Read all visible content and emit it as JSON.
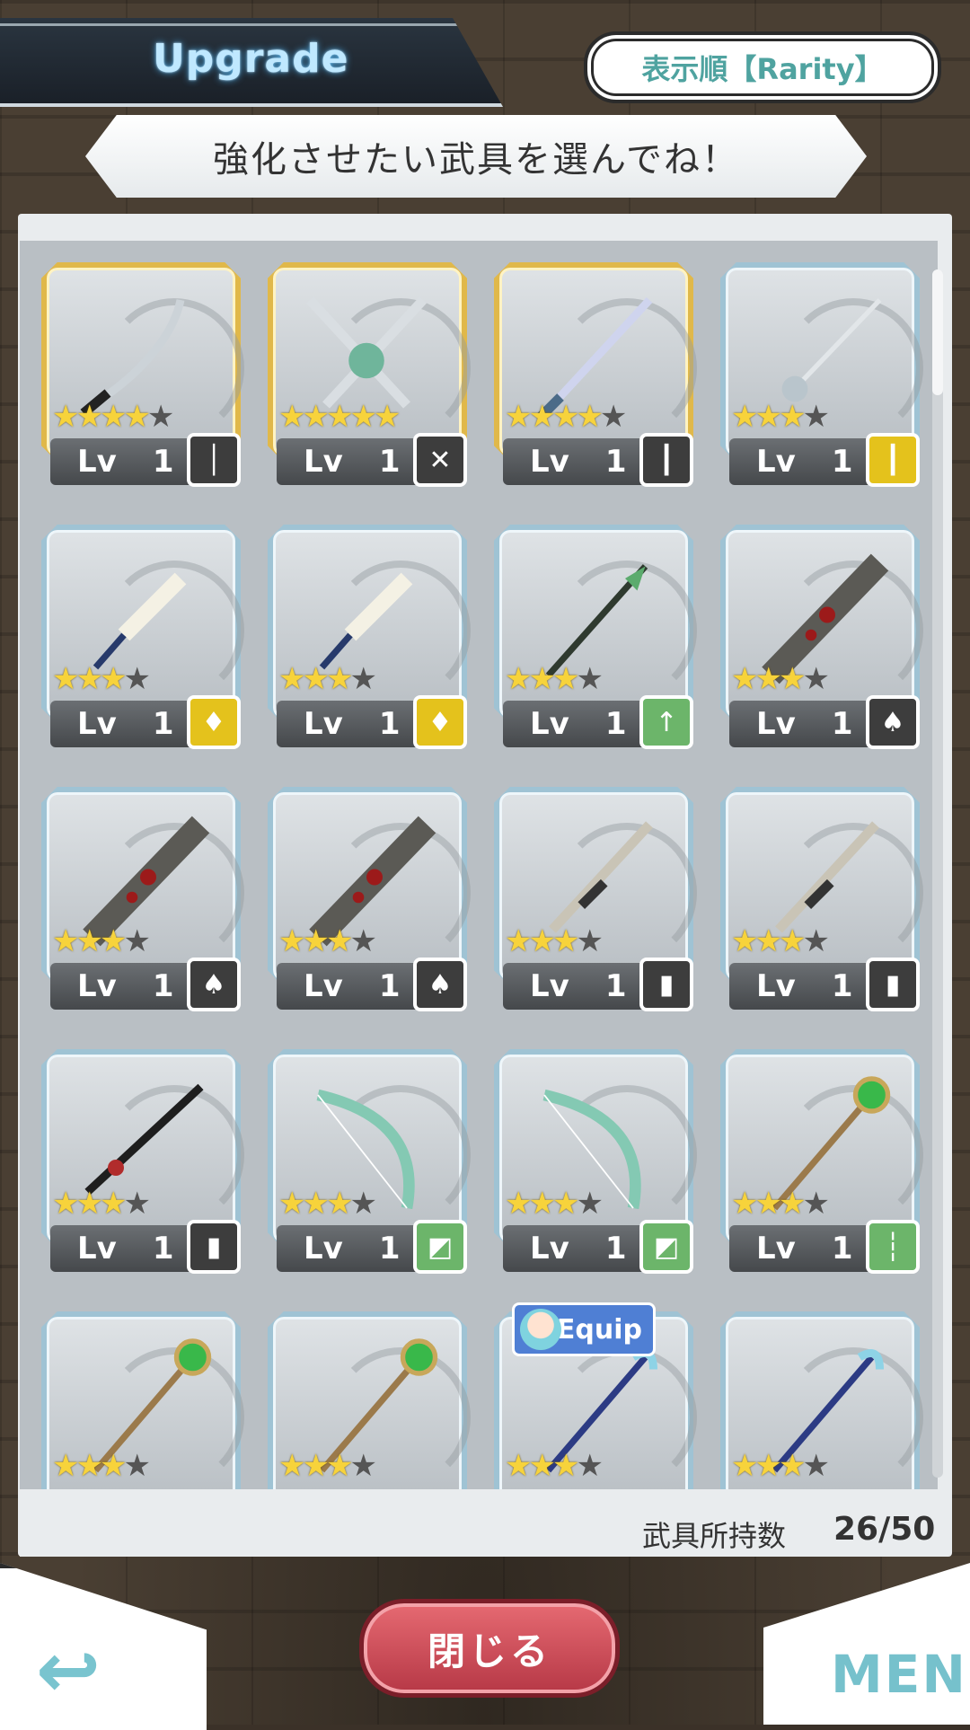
{
  "header": {
    "title": "Upgrade",
    "sort_label": "表示順【Rarity】",
    "instruction": "強化させたい武具を選んでね！"
  },
  "colors": {
    "accent": "#76c1cc",
    "gold_frame": "#e0b84a",
    "silver_frame": "#9fc3d4",
    "star": "#f7d33b",
    "close_button": "#c94b57",
    "badge_yellow": "#e4c21c",
    "badge_green": "#6cb56a",
    "badge_dark": "#3d3d3d"
  },
  "inventory": {
    "label": "武具所持数",
    "count": "26/50"
  },
  "items": [
    {
      "rarity": 4,
      "max": 5,
      "level": "1",
      "frame": "gold",
      "badge": "dark",
      "badge_icon": "sword-icon",
      "art": "katana"
    },
    {
      "rarity": 5,
      "max": 5,
      "level": "1",
      "frame": "gold",
      "badge": "dark",
      "badge_icon": "dual-swords-icon",
      "art": "crossed-swords"
    },
    {
      "rarity": 4,
      "max": 5,
      "level": "1",
      "frame": "gold",
      "badge": "dark",
      "badge_icon": "rapier-icon",
      "art": "long-sword"
    },
    {
      "rarity": 3,
      "max": 4,
      "level": "1",
      "frame": "silver",
      "badge": "yellow",
      "badge_icon": "rapier-icon",
      "art": "rapier"
    },
    {
      "rarity": 3,
      "max": 4,
      "level": "1",
      "frame": "silver",
      "badge": "yellow",
      "badge_icon": "dagger-icon",
      "art": "dagger"
    },
    {
      "rarity": 3,
      "max": 4,
      "level": "1",
      "frame": "silver",
      "badge": "yellow",
      "badge_icon": "dagger-icon",
      "art": "dagger"
    },
    {
      "rarity": 3,
      "max": 4,
      "level": "1",
      "frame": "silver",
      "badge": "green",
      "badge_icon": "spear-icon",
      "art": "spear"
    },
    {
      "rarity": 3,
      "max": 4,
      "level": "1",
      "frame": "silver",
      "badge": "dark",
      "badge_icon": "mace-icon",
      "art": "club"
    },
    {
      "rarity": 3,
      "max": 4,
      "level": "1",
      "frame": "silver",
      "badge": "dark",
      "badge_icon": "mace-icon",
      "art": "club"
    },
    {
      "rarity": 3,
      "max": 4,
      "level": "1",
      "frame": "silver",
      "badge": "dark",
      "badge_icon": "mace-icon",
      "art": "club"
    },
    {
      "rarity": 3,
      "max": 4,
      "level": "1",
      "frame": "silver",
      "badge": "dark",
      "badge_icon": "bullet-icon",
      "art": "rifle"
    },
    {
      "rarity": 3,
      "max": 4,
      "level": "1",
      "frame": "silver",
      "badge": "dark",
      "badge_icon": "bullet-icon",
      "art": "rifle"
    },
    {
      "rarity": 3,
      "max": 4,
      "level": "1",
      "frame": "silver",
      "badge": "dark",
      "badge_icon": "bullet-icon",
      "art": "sniper"
    },
    {
      "rarity": 3,
      "max": 4,
      "level": "1",
      "frame": "silver",
      "badge": "green",
      "badge_icon": "bow-icon",
      "art": "bow"
    },
    {
      "rarity": 3,
      "max": 4,
      "level": "1",
      "frame": "silver",
      "badge": "green",
      "badge_icon": "bow-icon",
      "art": "bow"
    },
    {
      "rarity": 3,
      "max": 4,
      "level": "1",
      "frame": "silver",
      "badge": "green",
      "badge_icon": "staff-icon",
      "art": "staff"
    },
    {
      "rarity": 3,
      "max": 4,
      "level": "",
      "frame": "silver",
      "badge": "",
      "badge_icon": "",
      "art": "staff"
    },
    {
      "rarity": 3,
      "max": 4,
      "level": "",
      "frame": "silver",
      "badge": "",
      "badge_icon": "",
      "art": "staff"
    },
    {
      "rarity": 3,
      "max": 4,
      "level": "",
      "frame": "silver",
      "badge": "",
      "badge_icon": "",
      "art": "blue-staff",
      "equip": "Equip"
    },
    {
      "rarity": 3,
      "max": 4,
      "level": "",
      "frame": "silver",
      "badge": "",
      "badge_icon": "",
      "art": "blue-staff"
    }
  ],
  "level_prefix": "Lv",
  "footer": {
    "close_label": "閉じる",
    "menu_label": "MENU"
  }
}
